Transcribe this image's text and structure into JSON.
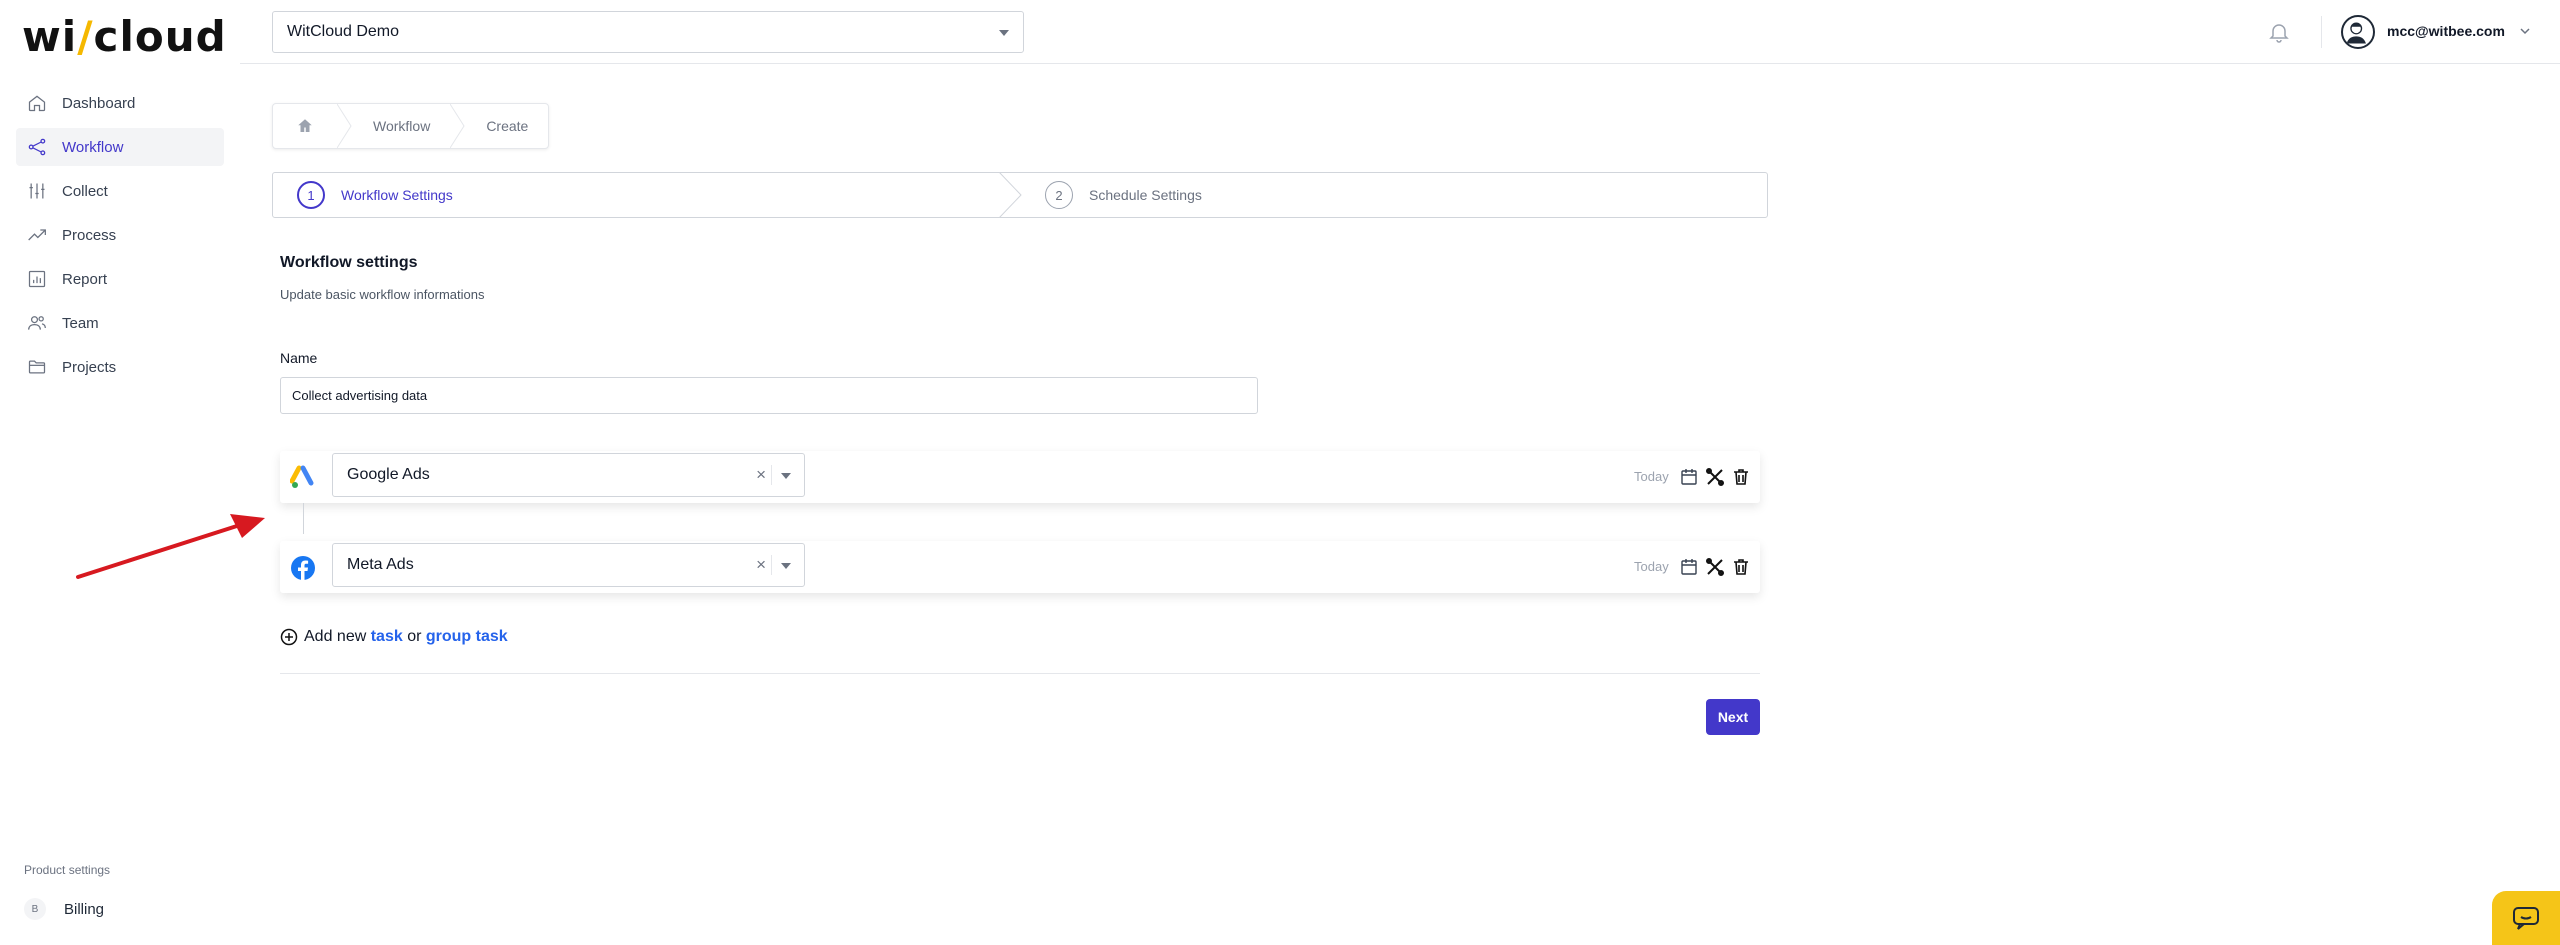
{
  "brand": {
    "logo_prefix": "wi",
    "logo_slash": "/",
    "logo_suffix": "cloud",
    "accent": "#4338ca",
    "logo_accent": "#f5b800"
  },
  "sidebar": {
    "items": [
      {
        "label": "Dashboard",
        "icon": "home-icon",
        "active": false
      },
      {
        "label": "Workflow",
        "icon": "workflow-icon",
        "active": true
      },
      {
        "label": "Collect",
        "icon": "sliders-icon",
        "active": false
      },
      {
        "label": "Process",
        "icon": "trend-icon",
        "active": false
      },
      {
        "label": "Report",
        "icon": "report-icon",
        "active": false
      },
      {
        "label": "Team",
        "icon": "team-icon",
        "active": false
      },
      {
        "label": "Projects",
        "icon": "folder-icon",
        "active": false
      }
    ],
    "product_settings": "Product settings",
    "billing": {
      "label": "Billing",
      "icon_text": "B"
    }
  },
  "header": {
    "workspace": "WitCloud Demo",
    "user_email": "mcc@witbee.com"
  },
  "breadcrumb": {
    "items": [
      "Workflow",
      "Create"
    ]
  },
  "steps": [
    {
      "number": "1",
      "label": "Workflow Settings",
      "active": true
    },
    {
      "number": "2",
      "label": "Schedule Settings",
      "active": false
    }
  ],
  "form": {
    "title": "Workflow settings",
    "description": "Update basic workflow informations",
    "name_label": "Name",
    "name_value": "Collect advertising data"
  },
  "tasks": [
    {
      "source": "Google Ads",
      "logo": "google-ads-icon",
      "clear": "×",
      "schedule": "Today"
    },
    {
      "source": "Meta Ads",
      "logo": "facebook-icon",
      "clear": "×",
      "schedule": "Today"
    }
  ],
  "add_task": {
    "prefix": "Add new ",
    "task_link": "task",
    "middle": " or ",
    "group_link": "group task"
  },
  "next_button": "Next"
}
